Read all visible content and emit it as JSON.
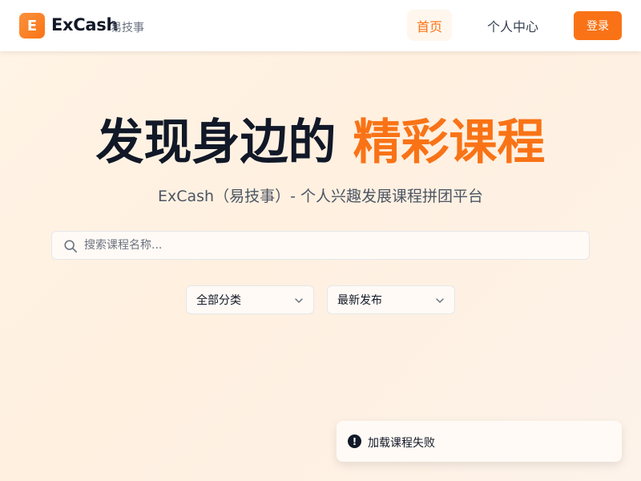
{
  "header": {
    "logo_letter": "E",
    "brand": "ExCash",
    "brand_sub": "易技事",
    "nav": {
      "home": "首页",
      "user_center": "个人中心"
    },
    "login_label": "登录"
  },
  "hero": {
    "title_main": "发现身边的",
    "title_accent": "精彩课程",
    "subtitle": "ExCash（易技事）- 个人兴趣发展课程拼团平台"
  },
  "search": {
    "placeholder": "搜索课程名称..."
  },
  "filters": {
    "category": "全部分类",
    "sort": "最新发布"
  },
  "toast": {
    "message": "加载课程失败"
  },
  "colors": {
    "accent": "#f97316",
    "accent_light": "#fff7ed",
    "text_dark": "#111827"
  },
  "icons": {
    "search": "search-icon",
    "chevron": "chevron-down-icon",
    "error": "error-icon"
  }
}
